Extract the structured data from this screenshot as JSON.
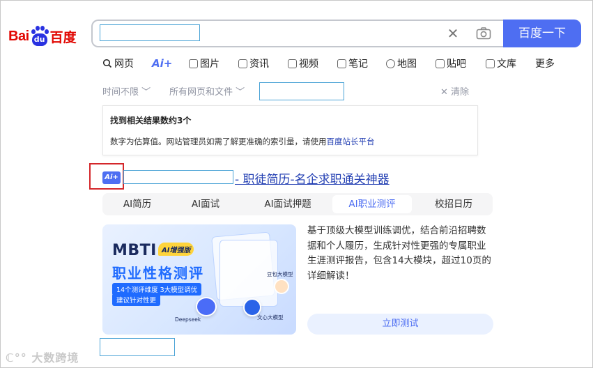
{
  "logo": {
    "bai": "Bai",
    "du": "du",
    "cn": "百度"
  },
  "search": {
    "button_label": "百度一下",
    "clear_glyph": "✕"
  },
  "tabs": [
    {
      "label": "网页",
      "icon": "search-icon"
    },
    {
      "label": "Ai+",
      "icon": "ai-icon"
    },
    {
      "label": "图片",
      "icon": "image-icon"
    },
    {
      "label": "资讯",
      "icon": "news-icon"
    },
    {
      "label": "视频",
      "icon": "video-icon"
    },
    {
      "label": "笔记",
      "icon": "notes-icon"
    },
    {
      "label": "地图",
      "icon": "map-icon"
    },
    {
      "label": "贴吧",
      "icon": "tieba-icon"
    },
    {
      "label": "文库",
      "icon": "wenku-icon"
    },
    {
      "label": "更多",
      "icon": ""
    }
  ],
  "filters": {
    "time": "时间不限",
    "scope": "所有网页和文件",
    "clear": "清除"
  },
  "info": {
    "title": "找到相关结果数约3个",
    "desc_prefix": "数字为估算值。网站管理员如需了解更准确的索引量，请使用",
    "desc_link": "百度站长平台"
  },
  "result": {
    "ai_badge": "Ai+",
    "title_suffix": "- 职徒简历-名企求职通关神器",
    "subtabs": [
      "AI简历",
      "AI面试",
      "AI面试押题",
      "AI职业测评",
      "校招日历"
    ],
    "active_subtab": 3,
    "banner": {
      "mbti": "MBTI",
      "tag": "AI增强版",
      "headline": "职业性格测评",
      "pill1": "14个测评维度 3大模型调优",
      "pill2": "建议针对性更",
      "label_deepseek": "Deepseek",
      "label_wenxin": "文心大模型",
      "label_doubao": "豆包大模型"
    },
    "description": "基于顶级大模型训练调优，结合前沿招聘数据和个人履历，生成针对性更强的专属职业生涯测评报告，包含14大模块，超过10页的详细解读！",
    "cta": "立即测试"
  },
  "watermark": "大数跨境",
  "colors": {
    "brand_blue": "#4e6ef2",
    "link_blue": "#2440b3",
    "logo_red": "#e10601",
    "highlight_red": "#d4272b"
  }
}
